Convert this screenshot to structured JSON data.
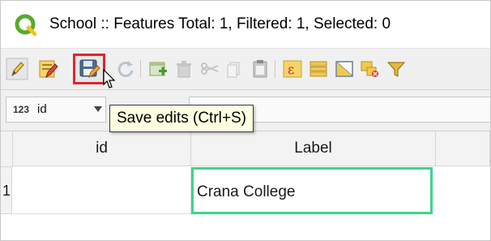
{
  "window": {
    "title": "School :: Features Total: 1, Filtered: 1, Selected: 0"
  },
  "toolbar": {
    "buttons": [
      {
        "icon": "pencil-toggle-editing-icon"
      },
      {
        "icon": "multi-edit-icon"
      },
      {
        "icon": "save-edits-icon",
        "highlighted": true
      },
      {
        "icon": "reload-icon"
      },
      {
        "icon": "add-feature-icon"
      },
      {
        "icon": "delete-feature-icon"
      },
      {
        "icon": "cut-icon"
      },
      {
        "icon": "copy-icon"
      },
      {
        "icon": "paste-icon"
      },
      {
        "icon": "expression-select-icon"
      },
      {
        "icon": "select-all-icon"
      },
      {
        "icon": "invert-selection-icon"
      },
      {
        "icon": "deselect-icon"
      },
      {
        "icon": "filter-icon"
      }
    ],
    "tooltip": "Save edits (Ctrl+S)"
  },
  "filter": {
    "field_type": "123",
    "field_name": "id"
  },
  "table": {
    "columns": [
      "id",
      "Label"
    ],
    "rows": [
      {
        "row_number": "1",
        "id": "",
        "label": "Crana College"
      }
    ]
  },
  "colors": {
    "highlight_border": "#e0262d",
    "selected_cell_border": "#3ed58a",
    "tooltip_bg": "#ffffe1"
  }
}
